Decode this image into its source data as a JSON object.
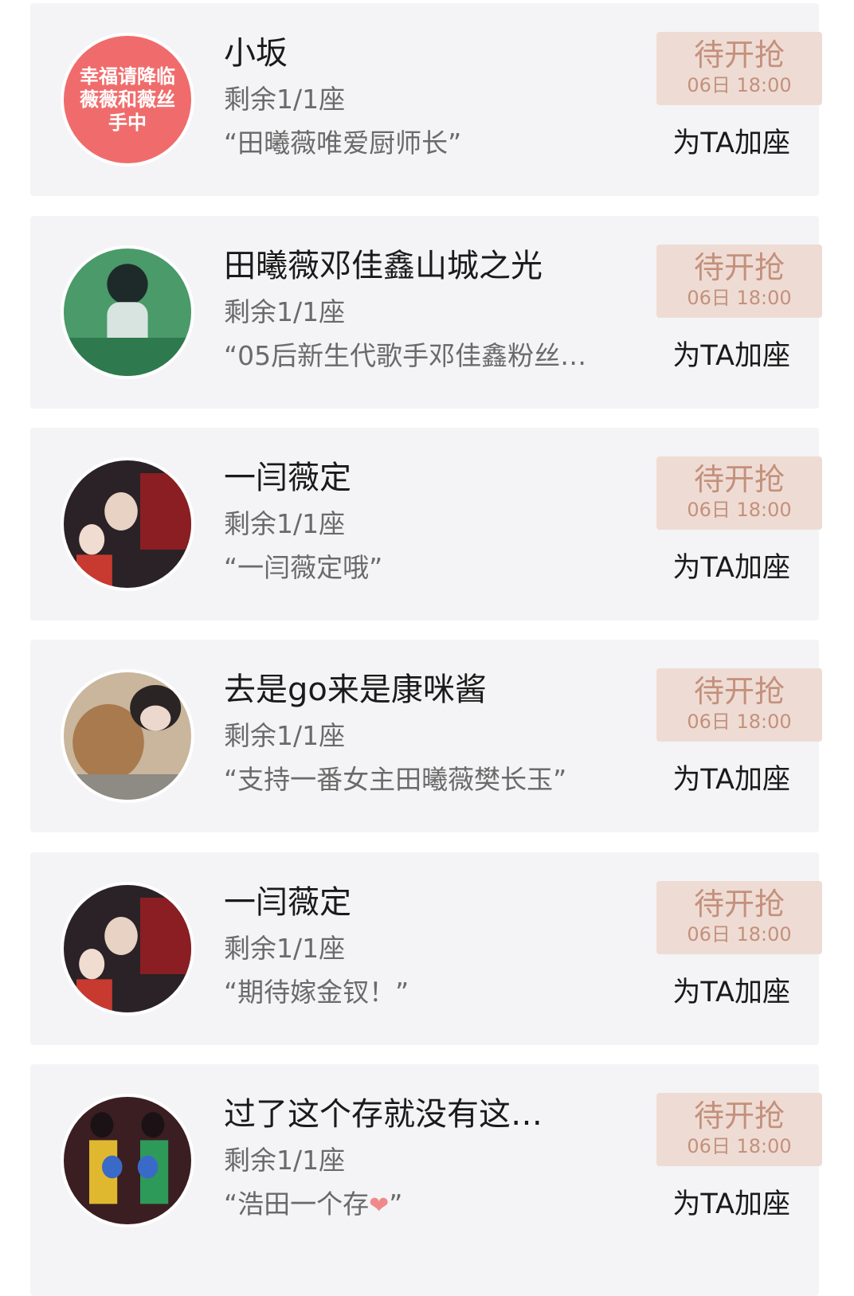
{
  "items": [
    {
      "name": "小坂",
      "seats": "剩余1/1座",
      "quote": "“田曦薇唯爱厨师长”",
      "avatar_text": "幸福请降临薇薇和薇丝手中",
      "avatar_color": "#f06c6c",
      "status": "待开抢",
      "time": "06日 18:00",
      "action": "为TA加座"
    },
    {
      "name": "田曦薇邓佳鑫山城之光",
      "seats": "剩余1/1座",
      "quote": "“05后新生代歌手邓佳鑫粉丝祝…",
      "avatar_text": "",
      "avatar_color": "#4a9a6a",
      "status": "待开抢",
      "time": "06日 18:00",
      "action": "为TA加座"
    },
    {
      "name": "一闫薇定",
      "seats": "剩余1/1座",
      "quote": "“一闫薇定哦”",
      "avatar_text": "",
      "avatar_color": "#2a2226",
      "status": "待开抢",
      "time": "06日 18:00",
      "action": "为TA加座"
    },
    {
      "name": "去是go来是康咪酱",
      "seats": "剩余1/1座",
      "quote": "“支持一番女主田曦薇樊长玉”",
      "avatar_text": "",
      "avatar_color": "#b59774",
      "status": "待开抢",
      "time": "06日 18:00",
      "action": "为TA加座"
    },
    {
      "name": "一闫薇定",
      "seats": "剩余1/1座",
      "quote": "“期待嫁金钗！”",
      "avatar_text": "",
      "avatar_color": "#2a2226",
      "status": "待开抢",
      "time": "06日 18:00",
      "action": "为TA加座"
    },
    {
      "name": "过了这个存就没有这…",
      "seats": "剩余1/1座",
      "quote": "“浩田一个存",
      "quote_end": "”",
      "avatar_text": "",
      "avatar_color": "#3a1e22",
      "status": "待开抢",
      "time": "06日 18:00",
      "action": "为TA加座"
    }
  ]
}
